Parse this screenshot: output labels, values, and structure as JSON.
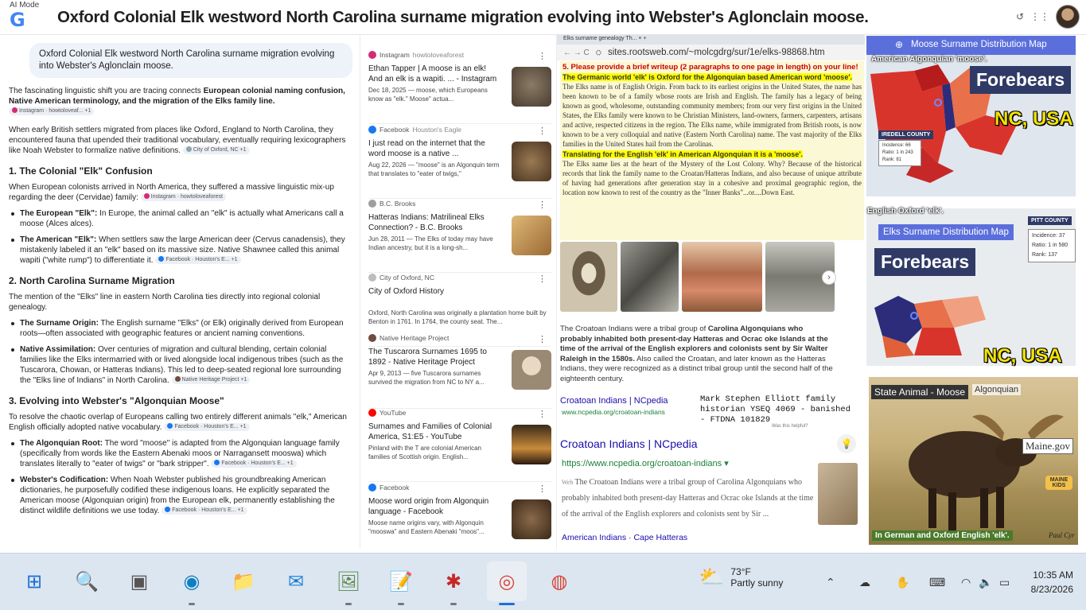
{
  "topbar": {
    "mode_label": "AI Mode",
    "title": "Oxford Colonial Elk westword North Carolina surname migration  evolving into Webster's Aglonclain moose."
  },
  "left": {
    "query": "Oxford Colonial Elk westword North Carolina surname migration evolving into Webster's Aglonclain moose.",
    "intro1": "The fascinating linguistic shift you are tracing connects ",
    "intro1b": "European colonial naming confusion, Native American terminology, and the migration of the Elks family line.",
    "chip_instagram": "Instagram · howtoloveaf...  +1",
    "intro2": "When early British settlers migrated from places like Oxford, England to North Carolina, they encountered fauna that upended their traditional vocabulary, eventually requiring lexicographers like Noah Webster to formalize native definitions.",
    "chip_oxford": "City of Oxford, NC +1",
    "h1": "1. The Colonial \"Elk\" Confusion",
    "s1_intro": "When European colonists arrived in North America, they suffered a massive linguistic mix-up regarding the deer (Cervidae) family:",
    "chip_instagram2": "Instagram · howtoloveaforest",
    "s1_b1_bold": "The European \"Elk\":",
    "s1_b1": " In Europe, the animal called an \"elk\" is actually what Americans call a moose (Alces alces).",
    "s1_b2_bold": "The American \"Elk\":",
    "s1_b2": " When settlers saw the large American deer (Cervus canadensis), they mistakenly labeled it an \"elk\" based on its massive size. Native Shawnee called this animal wapiti (\"white rump\") to differentiate it.",
    "chip_facebook1": "Facebook · Houston's E... +1",
    "h2": "2. North Carolina Surname Migration",
    "s2_intro": "The mention of the \"Elks\" line in eastern North Carolina ties directly into regional colonial genealogy.",
    "s2_b1_bold": "The Surname Origin:",
    "s2_b1": " The English surname \"Elks\" (or Elk) originally derived from European roots—often associated with geographic features or ancient naming conventions.",
    "s2_b2_bold": "Native Assimilation:",
    "s2_b2": " Over centuries of migration and cultural blending, certain colonial families like the Elks intermarried with or lived alongside local indigenous tribes (such as the Tuscarora, Chowan, or Hatteras Indians). This led to deep-seated regional lore surrounding the \"Elks line of Indians\" in North Carolina.",
    "chip_nhp": "Native Heritage Project +1",
    "h3": "3. Evolving into Webster's \"Algonquian Moose\"",
    "s3_intro": "To resolve the chaotic overlap of Europeans calling two entirely different animals \"elk,\" American English officially adopted native vocabulary.",
    "chip_facebook2": "Facebook · Houston's E... +1",
    "s3_b1_bold": "The Algonquian Root:",
    "s3_b1": " The word \"moose\" is adapted from the Algonquian language family (specifically from words like the Eastern Abenaki moos or Narragansett mooswa) which translates literally to \"eater of twigs\" or \"bark stripper\".",
    "chip_facebook3": "Facebook · Houston's E... +1",
    "s3_b2_bold": "Webster's Codification:",
    "s3_b2": " When Noah Webster published his groundbreaking American dictionaries, he purposefully codified these indigenous loans. He explicitly separated the American moose (Algonquian origin) from the European elk, permanently establishing the distinct wildlife definitions we use today.",
    "chip_facebook4": "Facebook · Houston's E... +1"
  },
  "results": [
    {
      "source": "Instagram",
      "handle": "howtoloveaforest",
      "title": "Ethan Tapper | A moose is an elk! And an elk is a wapiti. ... - Instagram",
      "snippet": "Dec 18, 2025 — moose, which Europeans know as \"elk.\" Moose\" actua...",
      "color": "#d62976",
      "thumb": "#6b5a48"
    },
    {
      "source": "Facebook",
      "handle": "Houston's Eagle",
      "title": "I just read on the internet that the word moose is a native ...",
      "snippet": "Aug 22, 2026 — \"moose\" is an Algonquin term that translates to \"eater of twigs,\"",
      "color": "#1877f2",
      "thumb": "#7a5a3a"
    },
    {
      "source": "B.C. Brooks",
      "handle": "",
      "title": "Hatteras Indians: Matrilineal Elks Connection? - B.C. Brooks",
      "snippet": "Jun 28, 2011 — The Elks of today may have Indian ancestry, but it is a long-sh...",
      "color": "#9e9e9e",
      "thumb": "#c89a5c"
    },
    {
      "source": "City of Oxford, NC",
      "handle": "",
      "title": "City of Oxford History",
      "snippet": "Oxford, North Carolina was originally a plantation home built by Benton in 1761. In 1764, the county seat. The...",
      "color": "#bdbdbd",
      "thumb": ""
    },
    {
      "source": "Native Heritage Project",
      "handle": "",
      "title": "The Tuscarora Surnames 1695 to 1892 - Native Heritage Project",
      "snippet": "Apr 9, 2013 — five Tuscarora surnames survived the migration from NC to NY a...",
      "color": "#6d4c41",
      "thumb": "#b8a58a"
    },
    {
      "source": "YouTube",
      "handle": "",
      "title": "Surnames and Families of Colonial America, S1:E5 - YouTube",
      "snippet": "Pinland with the T are colonial American families of Scottish origin. English...",
      "color": "#ff0000",
      "thumb": "#8a6a3a"
    },
    {
      "source": "Facebook",
      "handle": "",
      "title": "Moose word origin from Algonquin language - Facebook",
      "snippet": "Moose name origins vary, with Algonquin \"mooswa\" and Eastern Abenaki \"moos\"...",
      "color": "#1877f2",
      "thumb": "#6a5038"
    }
  ],
  "browser": {
    "tab_text": "Elks surname genealogy Th... ×  +",
    "url": "sites.rootsweb.com/~molcgdrg/sur/1e/elks-98868.htm",
    "instruction": "5.  Please provide a brief writeup (2 paragraphs to one page in length) on your line!",
    "hl1": "The Germanic world 'elk' is Oxford for the Algonquian based American word 'moose'.",
    "para1": "The Elks name is of English Origin.  From back to its earliest origins in the United States, the name has been known to be of a family whose roots are Irish and English.  The family has a legacy of being known as good, wholesome, outstanding community members; from our very first origins in the United States, the Elks family were known to be Christian Ministers, land-owners, farmers, carpenters, artisans and active, respected citizens in the region.   The Elks name, while immigrated from British roots, is now known to be a very colloquial and native (Eastern North Carolina) name. The vast majority of the Elks families in the United States hail from the Carolinas.",
    "hl2": "Translating for the English  'elk' in American Algonquian it is a 'moose'.",
    "para2": "The Elks name lies at the heart of the Mystery of the Lost Colony.  Why? Because of the historical records that link the family name to the Croatan/Hatteras Indians, and also because of unique attribute of having had generations after generation stay in a cohesive and proximal geographic region, the location now known to rest of the country as the \"Inner Banks\"...or....Down East.",
    "croatoan1": "The Croatoan Indians were a tribal group of ",
    "croatoan_bold": "Carolina Algonquians who probably inhabited both present-day Hatteras and Ocrac oke Islands at the time of the arrival of the English explorers and colonists sent by Sir Walter Raleigh in the 1580s.",
    "croatoan2": " Also called the Croatan, and later known as the Hatteras Indians, they were recognized as a distinct tribal group until the second half of the eighteenth century.",
    "ncped": "Croatoan Indians | NCpedia",
    "ncurl_small": "www.ncpedia.org/croatoan-indians",
    "elliott": "Mark Stephen Elliott family historian YSEQ 4069 - banished - FTDNA 101829",
    "helpful": "Was this helpful?",
    "ncped2": "Croatoan Indians | NCpedia",
    "ncurl2": "https://www.ncpedia.org/croatoan-indians ▾",
    "ncsnip_web": "Web ",
    "ncsnip": "The Croatoan Indians were a tribal group of Carolina Algonquians who probably inhabited both present-day Hatteras and Ocrac oke Islands at the time of the arrival of the English explorers and colonists sent by Sir ...",
    "nclinks": "American Indians · Cape Hatteras"
  },
  "maps": {
    "m1_header": "Moose Surname Distribution Map",
    "m1_label": "American Algonquian 'moose'.",
    "m1_forebears": "Forebears",
    "m1_ncusa": "NC, USA",
    "m1_county": "IREDELL COUNTY",
    "m1_stat1": "Incidence: 66",
    "m1_stat2": "Ratio: 1 in 243",
    "m1_stat3": "Rank: 81",
    "m2_label": "English Oxford 'elk'.",
    "m2_header": "Elks Surname Distribution Map",
    "m2_forebears": "Forebears",
    "m2_ncusa": "NC, USA",
    "m2_county": "PITT COUNTY",
    "m2_stat1": "Incidence: 37",
    "m2_stat2": "Ratio: 1 in 580",
    "m2_stat3": "Rank: 137",
    "m3_title": "State Animal - Moose",
    "m3_alg": "Algonquian",
    "m3_maine": "Maine.gov",
    "m3_kids": "MAINE KIDS",
    "m3_bottom": "In German and Oxford English 'elk'.",
    "m3_sig": "Paul Cyr"
  },
  "taskbar": {
    "temp": "73°F",
    "weather": "Partly sunny",
    "time": "10:35 AM",
    "date": "8/23/2026"
  }
}
